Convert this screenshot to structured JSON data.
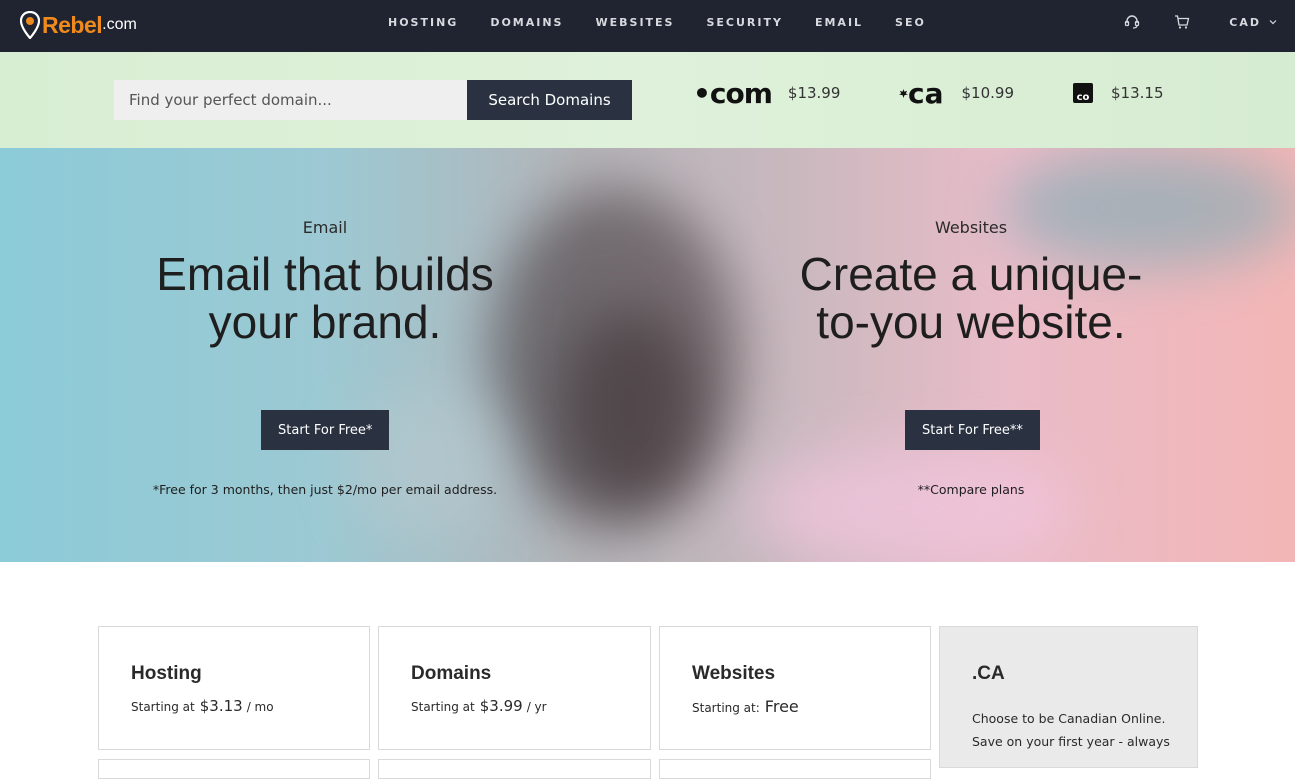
{
  "brand": {
    "name": "Rebel",
    "domain": ".com",
    "color": "#f08a1c"
  },
  "nav": {
    "links": [
      "HOSTING",
      "DOMAINS",
      "WEBSITES",
      "SECURITY",
      "EMAIL",
      "SEO"
    ],
    "currency": "CAD",
    "icons": [
      "support-headset-icon",
      "cart-icon",
      "chevron-down-icon"
    ]
  },
  "search": {
    "placeholder": "Find your perfect domain...",
    "button": "Search Domains",
    "tlds": [
      {
        "name": ".com",
        "logo": "•com",
        "price": "$13.99"
      },
      {
        "name": ".ca",
        "logo": "ca",
        "price": "$10.99"
      },
      {
        "name": ".co",
        "logo": "co",
        "price": "$13.15"
      }
    ]
  },
  "hero": {
    "left": {
      "eyebrow": "Email",
      "headline_line1": "Email that builds",
      "headline_line2": "your brand.",
      "cta": "Start For Free*",
      "note": "*Free for 3 months, then just $2/mo per email address."
    },
    "right": {
      "eyebrow": "Websites",
      "headline_line1": "Create a unique-",
      "headline_line2": "to-you website.",
      "cta": "Start For Free**",
      "note": "**Compare plans"
    }
  },
  "cards": [
    {
      "title": "Hosting",
      "label": "Starting at",
      "price": "$3.13",
      "unit": "/ mo"
    },
    {
      "title": "Domains",
      "label": "Starting at",
      "price": "$3.99",
      "unit": "/ yr"
    },
    {
      "title": "Websites",
      "label": "Starting at:",
      "price": "Free",
      "unit": ""
    },
    {
      "title": ".CA",
      "desc_line1": "Choose to be Canadian Online.",
      "desc_line2": "Save on your first year - always"
    }
  ],
  "colors": {
    "nav_bg": "#1f2430",
    "button_bg": "#2a3242",
    "search_band": "#d8eed3"
  }
}
